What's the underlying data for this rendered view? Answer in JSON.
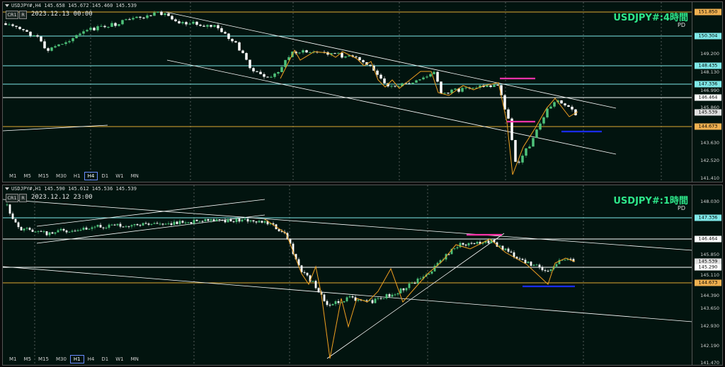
{
  "top": {
    "header": "USDJPY#,H4  145.658 145.672 145.460 145.539",
    "btn_cr1": "CR1",
    "btn_r": "R",
    "timestamp": "2023.12.13 00:00",
    "title": "USDJPY#:4時間",
    "sub": "PD",
    "ticks": [
      "151.590",
      "150.304",
      "149.200",
      "148.130",
      "146.990",
      "145.860",
      "143.630",
      "142.520",
      "141.410"
    ],
    "tags": [
      {
        "label": "151.850",
        "bg": "#f0b050",
        "fg": "#000000"
      },
      {
        "label": "150.304",
        "bg": "#7fe8e8",
        "fg": "#000000"
      },
      {
        "label": "148.435",
        "bg": "#7fe8e8",
        "fg": "#000000"
      },
      {
        "label": "147.336",
        "bg": "#7fe8e8",
        "fg": "#000000"
      },
      {
        "label": "146.464",
        "bg": "#ffffff",
        "fg": "#000000"
      },
      {
        "label": "145.539",
        "bg": "#e0e0e0",
        "fg": "#000000"
      },
      {
        "label": "144.673",
        "bg": "#f0b050",
        "fg": "#000000"
      }
    ],
    "timeframes": [
      "M1",
      "M5",
      "M15",
      "M30",
      "H1",
      "H4",
      "D1",
      "W1",
      "MN"
    ],
    "active_tf": "H4"
  },
  "bot": {
    "header": "USDJPY#,H1  145.590 145.612 145.536 145.539",
    "btn_cr1": "CR1",
    "btn_r": "R",
    "timestamp": "2023.12.12 23:00",
    "title": "USDJPY#:1時間",
    "sub": "PD",
    "ticks": [
      "148.030",
      "145.850",
      "145.110",
      "144.390",
      "143.650",
      "142.930",
      "142.190",
      "141.470"
    ],
    "tags": [
      {
        "label": "147.336",
        "bg": "#7fe8e8",
        "fg": "#000000"
      },
      {
        "label": "146.464",
        "bg": "#ffffff",
        "fg": "#000000"
      },
      {
        "label": "145.539",
        "bg": "#e0e0e0",
        "fg": "#000000"
      },
      {
        "label": "145.290",
        "bg": "#ffffff",
        "fg": "#000000"
      },
      {
        "label": "144.673",
        "bg": "#f0b050",
        "fg": "#000000"
      }
    ],
    "timeframes": [
      "M1",
      "M5",
      "M15",
      "M30",
      "H1",
      "H4",
      "D1",
      "W1",
      "MN"
    ],
    "active_tf": "H1"
  },
  "colors": {
    "bull": "#4ec27a",
    "bear": "#ffffff",
    "resistance": "#7fe8e8",
    "gold": "#e0a830",
    "zigzag": "#f0a020",
    "magenta": "#ff33aa",
    "blue": "#1a2cff"
  }
}
